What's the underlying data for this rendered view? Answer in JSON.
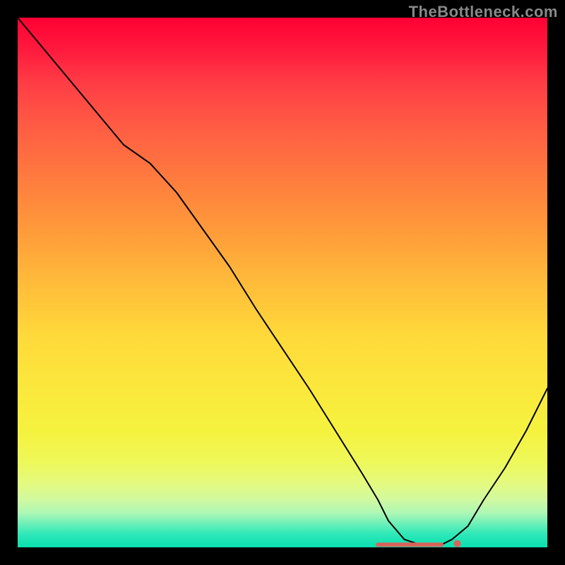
{
  "watermark": "TheBottleneck.com",
  "colors": {
    "curve": "#000000",
    "marker": "#d8645a",
    "bg_top": "#ff0033",
    "bg_bottom": "#0ae0b0",
    "page_bg": "#000000"
  },
  "chart_data": {
    "type": "line",
    "title": "",
    "xlabel": "",
    "ylabel": "",
    "xlim": [
      0,
      100
    ],
    "ylim": [
      0,
      100
    ],
    "grid": false,
    "note": "No axis tick labels or numeric labels are visible; values are estimated from pixel position on a 0–100 normalized scale. Vertical gradient encodes value magnitude (red high → green low).",
    "series": [
      {
        "name": "bottleneck-curve",
        "x": [
          0,
          5,
          10,
          15,
          20,
          25,
          30,
          35,
          40,
          45,
          50,
          55,
          60,
          65,
          68,
          70,
          73,
          76,
          80,
          82,
          85,
          88,
          92,
          96,
          100
        ],
        "y": [
          100,
          94,
          88,
          82,
          76,
          72.5,
          67,
          60,
          53,
          45,
          37.5,
          30,
          22,
          14,
          9,
          5,
          1.5,
          0.5,
          0.5,
          1.5,
          4,
          9,
          15,
          22,
          30
        ]
      }
    ],
    "annotations": [
      {
        "name": "baseline-marker",
        "type": "segment",
        "x0": 68,
        "x1": 80,
        "y": 0.5
      },
      {
        "name": "baseline-dot",
        "type": "point",
        "x": 83,
        "y": 0.7
      }
    ]
  }
}
